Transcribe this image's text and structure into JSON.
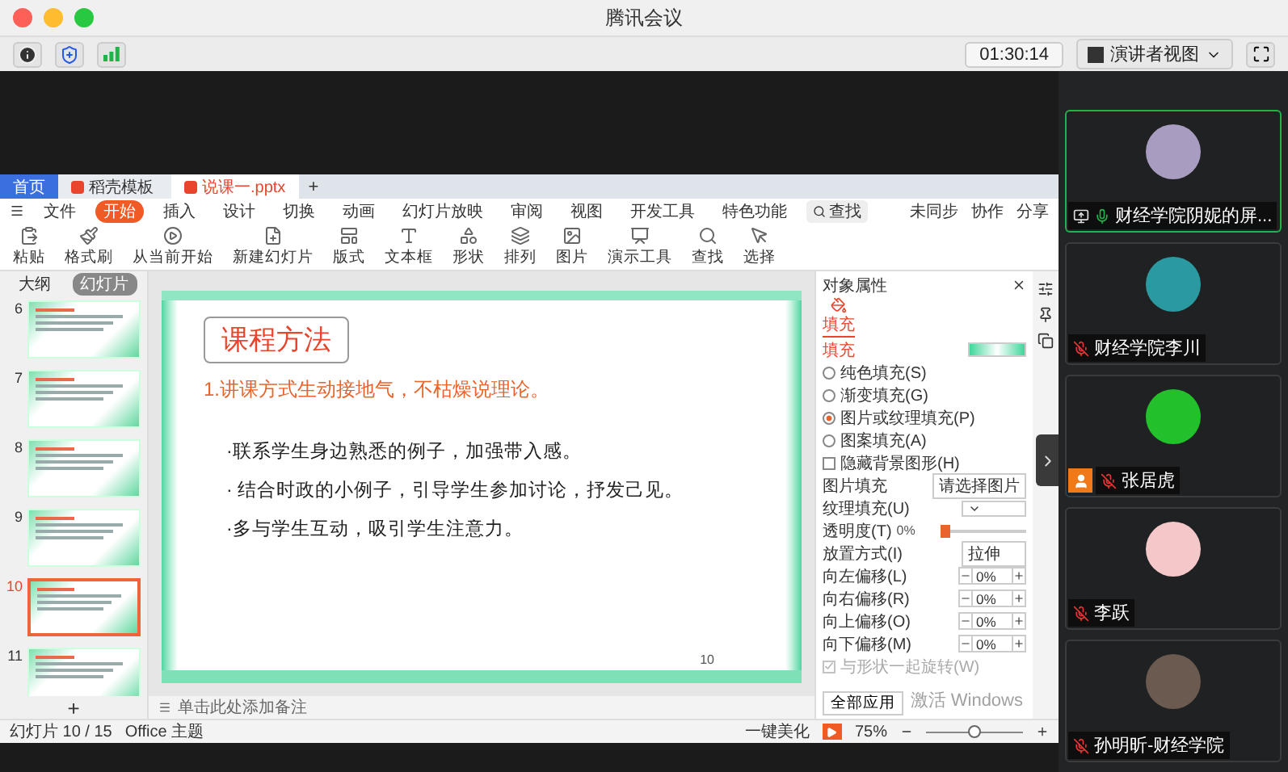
{
  "window": {
    "title": "腾讯会议"
  },
  "toolbar": {
    "timer": "01:30:14",
    "view_button": "演讲者视图"
  },
  "wps": {
    "tabs": [
      {
        "label": "首页",
        "selected": false,
        "kind": "home"
      },
      {
        "label": "稻壳模板",
        "selected": false,
        "kind": "template"
      },
      {
        "label": "说课一.pptx",
        "selected": true,
        "kind": "doc"
      }
    ],
    "new_tab": "+",
    "menu": [
      {
        "label": "文件",
        "selected": false
      },
      {
        "label": "开始",
        "selected": true
      },
      {
        "label": "插入",
        "selected": false
      },
      {
        "label": "设计",
        "selected": false
      },
      {
        "label": "切换",
        "selected": false
      },
      {
        "label": "动画",
        "selected": false
      },
      {
        "label": "幻灯片放映",
        "selected": false
      },
      {
        "label": "审阅",
        "selected": false
      },
      {
        "label": "视图",
        "selected": false
      },
      {
        "label": "开发工具",
        "selected": false
      },
      {
        "label": "特色功能",
        "selected": false
      }
    ],
    "search": "查找",
    "menu_right": [
      "未同步",
      "协作",
      "分享"
    ],
    "ribbon": [
      "粘贴",
      "格式刷",
      "从当前开始",
      "新建幻灯片",
      "版式",
      "文本框",
      "形状",
      "排列",
      "图片",
      "演示工具",
      "查找",
      "选择"
    ],
    "panel_tabs": [
      {
        "label": "大纲",
        "selected": false
      },
      {
        "label": "幻灯片",
        "selected": true
      }
    ],
    "thumbnails": [
      {
        "number": "6",
        "selected": false
      },
      {
        "number": "7",
        "selected": false
      },
      {
        "number": "8",
        "selected": false
      },
      {
        "number": "9",
        "selected": false
      },
      {
        "number": "10",
        "selected": true
      },
      {
        "number": "11",
        "selected": false
      }
    ],
    "add_slide": "+",
    "slide": {
      "title": "课程方法",
      "subtitle": "1.讲课方式生动接地气，不枯燥说理论。",
      "bullets": [
        "·联系学生身边熟悉的例子，加强带入感。",
        "· 结合时政的小例子，引导学生参加讨论，抒发己见。",
        "·多与学生互动，吸引学生注意力。"
      ],
      "page": "10"
    },
    "notes_placeholder": "单击此处添加备注",
    "properties": {
      "title": "对象属性",
      "tab": "填充",
      "section": "填充",
      "fill_options": [
        {
          "label": "纯色填充(S)",
          "selected": false
        },
        {
          "label": "渐变填充(G)",
          "selected": false
        },
        {
          "label": "图片或纹理填充(P)",
          "selected": true
        },
        {
          "label": "图案填充(A)",
          "selected": false
        }
      ],
      "hide_background": {
        "label": "隐藏背景图形(H)",
        "checked": false
      },
      "picture_fill": {
        "label": "图片填充",
        "value": "请选择图片"
      },
      "texture": {
        "label": "纹理填充(U)"
      },
      "transparency": {
        "label": "透明度(T)",
        "value": "0%",
        "level": 0
      },
      "placement": {
        "label": "放置方式(I)",
        "value": "拉伸"
      },
      "offsets": [
        {
          "label": "向左偏移(L)",
          "value": "0%"
        },
        {
          "label": "向右偏移(R)",
          "value": "0%"
        },
        {
          "label": "向上偏移(O)",
          "value": "0%"
        },
        {
          "label": "向下偏移(M)",
          "value": "0%"
        }
      ],
      "rotate": {
        "label": "与形状一起旋转(W)",
        "checked": true,
        "disabled": true
      },
      "apply_all": "全部应用"
    },
    "os_notice": "激活 Windows",
    "status": {
      "slide_count": "幻灯片 10 / 15",
      "theme": "Office 主题",
      "beautify": "一键美化",
      "zoom": "75%",
      "zoom_slider": {
        "level": 0.5
      }
    }
  },
  "participants": [
    {
      "name": "财经学院阴妮的屏...",
      "muted": false,
      "active": true,
      "sharing": true,
      "host": false,
      "color": "#a89cc0"
    },
    {
      "name": "财经学院李川",
      "muted": true,
      "active": false,
      "sharing": false,
      "host": false,
      "color": "#2a9aa0"
    },
    {
      "name": "张居虎",
      "muted": true,
      "active": false,
      "sharing": false,
      "host": true,
      "color": "#22c02a"
    },
    {
      "name": "李跃",
      "muted": true,
      "active": false,
      "sharing": false,
      "host": false,
      "color": "#f4c8c8"
    },
    {
      "name": "孙明昕-财经学院",
      "muted": true,
      "active": false,
      "sharing": false,
      "host": false,
      "color": "#6a5a50"
    }
  ]
}
